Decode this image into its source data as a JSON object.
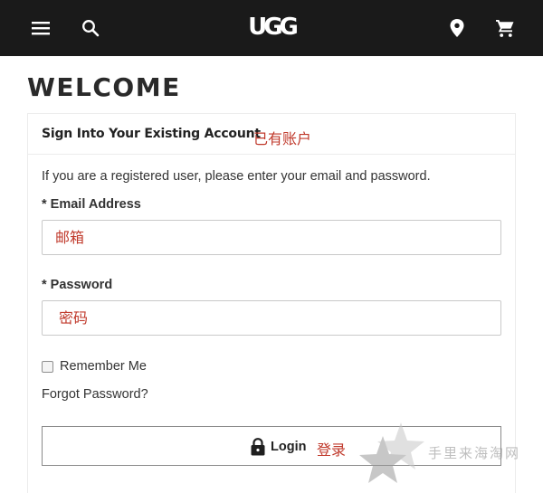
{
  "header": {
    "logo_text": "UGG",
    "icons": [
      "menu-icon",
      "search-icon",
      "location-pin-icon",
      "shopping-cart-icon"
    ],
    "background": "#1a1a1a"
  },
  "page_title": "WELCOME",
  "signin": {
    "title": "Sign Into Your Existing Account",
    "title_annotation": "已有账户",
    "intro": "If you are a registered user, please enter your email and password.",
    "email_label": "* Email Address",
    "email_placeholder": "邮箱",
    "password_label": "* Password",
    "password_placeholder": "密码",
    "remember_label": "Remember Me",
    "remember_checked": false,
    "forgot_label": "Forgot Password?",
    "login_label": "Login",
    "login_annotation": "登录"
  },
  "watermark": {
    "text": "手里来海淘网"
  },
  "colors": {
    "annotation": "#c0392b",
    "text": "#333333"
  }
}
